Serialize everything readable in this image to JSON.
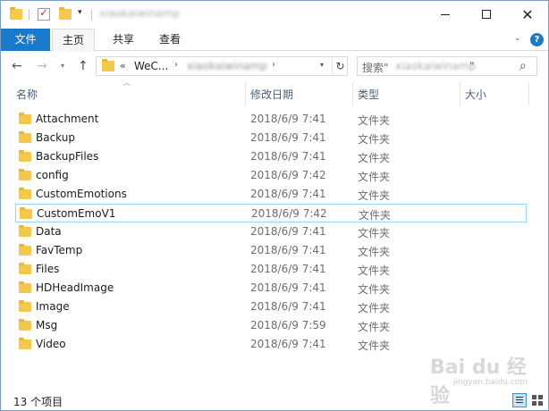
{
  "titlebar": {
    "title": "xiaokaiwinamp"
  },
  "ribbon": {
    "tabs": [
      {
        "label": "文件"
      },
      {
        "label": "主页"
      },
      {
        "label": "共享"
      },
      {
        "label": "查看"
      }
    ],
    "accent_color": "#1979ca"
  },
  "address": {
    "overflow": "«",
    "segment1": "WeC...",
    "segment2": "xiaokaiwinamp"
  },
  "search": {
    "prefix": "搜索\"",
    "middle": "xiaokaiwinamp",
    "suffix": "\""
  },
  "columns": {
    "name": "名称",
    "date": "修改日期",
    "type": "类型",
    "size": "大小"
  },
  "files": [
    {
      "name": "Attachment",
      "date": "2018/6/9 7:41",
      "type": "文件夹"
    },
    {
      "name": "Backup",
      "date": "2018/6/9 7:41",
      "type": "文件夹"
    },
    {
      "name": "BackupFiles",
      "date": "2018/6/9 7:41",
      "type": "文件夹"
    },
    {
      "name": "config",
      "date": "2018/6/9 7:42",
      "type": "文件夹"
    },
    {
      "name": "CustomEmotions",
      "date": "2018/6/9 7:41",
      "type": "文件夹"
    },
    {
      "name": "CustomEmoV1",
      "date": "2018/6/9 7:42",
      "type": "文件夹"
    },
    {
      "name": "Data",
      "date": "2018/6/9 7:41",
      "type": "文件夹"
    },
    {
      "name": "FavTemp",
      "date": "2018/6/9 7:41",
      "type": "文件夹"
    },
    {
      "name": "Files",
      "date": "2018/6/9 7:41",
      "type": "文件夹"
    },
    {
      "name": "HDHeadImage",
      "date": "2018/6/9 7:41",
      "type": "文件夹"
    },
    {
      "name": "Image",
      "date": "2018/6/9 7:41",
      "type": "文件夹"
    },
    {
      "name": "Msg",
      "date": "2018/6/9 7:59",
      "type": "文件夹"
    },
    {
      "name": "Video",
      "date": "2018/6/9 7:41",
      "type": "文件夹"
    }
  ],
  "status": {
    "item_count": "13 个项目"
  },
  "watermark": {
    "logo": "Bai du 经验",
    "sub": "jingyan.baidu.com"
  }
}
